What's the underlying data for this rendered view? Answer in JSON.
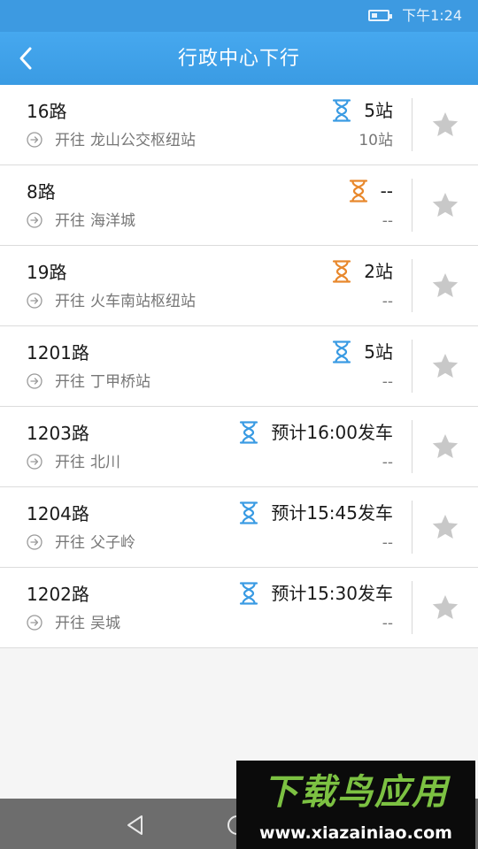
{
  "status_bar": {
    "time": "下午1:24"
  },
  "header": {
    "title": "行政中心下行"
  },
  "colors": {
    "accent": "#3d9ae1",
    "waiting_orange": "#e8882c",
    "waiting_blue": "#3a9be3",
    "star_gray": "#c8c8c8"
  },
  "routes": [
    {
      "name": "16路",
      "dest_prefix": "开往",
      "dest": "龙山公交枢纽站",
      "status": "5站",
      "sub": "10站",
      "icon": "hourglass-blue-icon"
    },
    {
      "name": "8路",
      "dest_prefix": "开往",
      "dest": "海洋城",
      "status": "--",
      "sub": "--",
      "icon": "hourglass-orange-icon"
    },
    {
      "name": "19路",
      "dest_prefix": "开往",
      "dest": "火车南站枢纽站",
      "status": "2站",
      "sub": "--",
      "icon": "hourglass-orange-icon"
    },
    {
      "name": "1201路",
      "dest_prefix": "开往",
      "dest": "丁甲桥站",
      "status": "5站",
      "sub": "--",
      "icon": "hourglass-blue-icon"
    },
    {
      "name": "1203路",
      "dest_prefix": "开往",
      "dest": "北川",
      "status": "预计16:00发车",
      "sub": "--",
      "icon": "hourglass-blue-icon"
    },
    {
      "name": "1204路",
      "dest_prefix": "开往",
      "dest": "父子岭",
      "status": "预计15:45发车",
      "sub": "--",
      "icon": "hourglass-blue-icon"
    },
    {
      "name": "1202路",
      "dest_prefix": "开往",
      "dest": "吴城",
      "status": "预计15:30发车",
      "sub": "--",
      "icon": "hourglass-blue-icon"
    }
  ],
  "watermark": {
    "title": "下载鸟应用",
    "url": "www.xiazainiao.com"
  }
}
